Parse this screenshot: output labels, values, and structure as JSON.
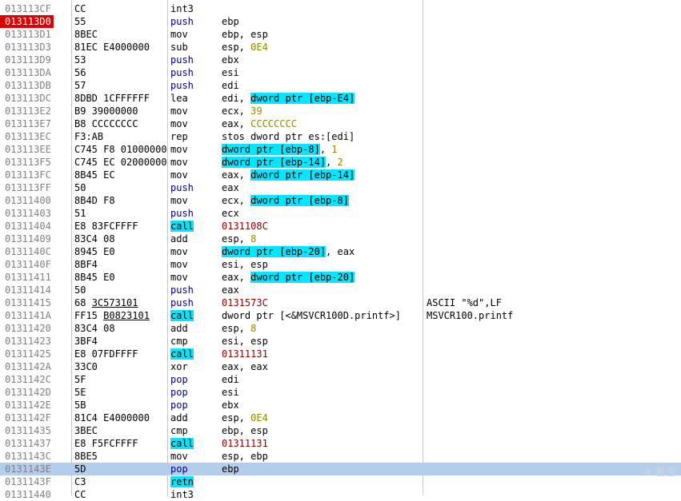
{
  "disassembly": {
    "rows": [
      {
        "addr": "013113CF",
        "hex": [
          {
            "t": "CC"
          }
        ],
        "mnemonic": "int3",
        "m_hl": false,
        "m_blue": false,
        "ops": [],
        "comment": ""
      },
      {
        "addr": "013113D0",
        "breakpoint": true,
        "hex": [
          {
            "t": "55"
          }
        ],
        "mnemonic": "push",
        "m_hl": false,
        "m_blue": true,
        "ops": [
          {
            "t": "ebp"
          }
        ],
        "comment": ""
      },
      {
        "addr": "013113D1",
        "hex": [
          {
            "t": "8BEC"
          }
        ],
        "mnemonic": "mov",
        "m_hl": false,
        "m_blue": false,
        "ops": [
          {
            "t": "ebp, esp"
          }
        ],
        "comment": ""
      },
      {
        "addr": "013113D3",
        "hex": [
          {
            "t": "81EC E4000000"
          }
        ],
        "mnemonic": "sub",
        "m_hl": false,
        "m_blue": false,
        "ops": [
          {
            "t": "esp, "
          },
          {
            "t": "0E4",
            "c": "num"
          }
        ],
        "comment": ""
      },
      {
        "addr": "013113D9",
        "hex": [
          {
            "t": "53"
          }
        ],
        "mnemonic": "push",
        "m_hl": false,
        "m_blue": true,
        "ops": [
          {
            "t": "ebx"
          }
        ],
        "comment": ""
      },
      {
        "addr": "013113DA",
        "hex": [
          {
            "t": "56"
          }
        ],
        "mnemonic": "push",
        "m_hl": false,
        "m_blue": true,
        "ops": [
          {
            "t": "esi"
          }
        ],
        "comment": ""
      },
      {
        "addr": "013113DB",
        "hex": [
          {
            "t": "57"
          }
        ],
        "mnemonic": "push",
        "m_hl": false,
        "m_blue": true,
        "ops": [
          {
            "t": "edi"
          }
        ],
        "comment": ""
      },
      {
        "addr": "013113DC",
        "hex": [
          {
            "t": "8DBD 1CFFFFFF"
          }
        ],
        "mnemonic": "lea",
        "m_hl": false,
        "m_blue": false,
        "ops": [
          {
            "t": "edi, "
          },
          {
            "t": "dword ptr [ebp-E4]",
            "c": "hl"
          }
        ],
        "comment": ""
      },
      {
        "addr": "013113E2",
        "hex": [
          {
            "t": "B9 39000000"
          }
        ],
        "mnemonic": "mov",
        "m_hl": false,
        "m_blue": false,
        "ops": [
          {
            "t": "ecx, "
          },
          {
            "t": "39",
            "c": "num"
          }
        ],
        "comment": ""
      },
      {
        "addr": "013113E7",
        "hex": [
          {
            "t": "B8 CCCCCCCC"
          }
        ],
        "mnemonic": "mov",
        "m_hl": false,
        "m_blue": false,
        "ops": [
          {
            "t": "eax, "
          },
          {
            "t": "CCCCCCCC",
            "c": "num"
          }
        ],
        "comment": ""
      },
      {
        "addr": "013113EC",
        "hex": [
          {
            "t": "F3:AB"
          }
        ],
        "mnemonic": "rep",
        "m_hl": false,
        "m_blue": false,
        "ops": [
          {
            "t": "stos dword ptr es:[edi]"
          }
        ],
        "comment": ""
      },
      {
        "addr": "013113EE",
        "hex": [
          {
            "t": "C745 F8 01000000"
          }
        ],
        "mnemonic": "mov",
        "m_hl": false,
        "m_blue": false,
        "ops": [
          {
            "t": "dword ptr [ebp-8]",
            "c": "hl"
          },
          {
            "t": ", "
          },
          {
            "t": "1",
            "c": "num"
          }
        ],
        "comment": ""
      },
      {
        "addr": "013113F5",
        "hex": [
          {
            "t": "C745 EC 02000000"
          }
        ],
        "mnemonic": "mov",
        "m_hl": false,
        "m_blue": false,
        "ops": [
          {
            "t": "dword ptr [ebp-14]",
            "c": "hl"
          },
          {
            "t": ", "
          },
          {
            "t": "2",
            "c": "num"
          }
        ],
        "comment": ""
      },
      {
        "addr": "013113FC",
        "hex": [
          {
            "t": "8B45 EC"
          }
        ],
        "mnemonic": "mov",
        "m_hl": false,
        "m_blue": false,
        "ops": [
          {
            "t": "eax, "
          },
          {
            "t": "dword ptr [ebp-14]",
            "c": "hl"
          }
        ],
        "comment": ""
      },
      {
        "addr": "013113FF",
        "hex": [
          {
            "t": "50"
          }
        ],
        "mnemonic": "push",
        "m_hl": false,
        "m_blue": true,
        "ops": [
          {
            "t": "eax"
          }
        ],
        "comment": ""
      },
      {
        "addr": "01311400",
        "hex": [
          {
            "t": "8B4D F8"
          }
        ],
        "mnemonic": "mov",
        "m_hl": false,
        "m_blue": false,
        "ops": [
          {
            "t": "ecx, "
          },
          {
            "t": "dword ptr [ebp-8]",
            "c": "hl"
          }
        ],
        "comment": ""
      },
      {
        "addr": "01311403",
        "hex": [
          {
            "t": "51"
          }
        ],
        "mnemonic": "push",
        "m_hl": false,
        "m_blue": true,
        "ops": [
          {
            "t": "ecx"
          }
        ],
        "comment": ""
      },
      {
        "addr": "01311404",
        "hex": [
          {
            "t": "E8 83FCFFFF"
          }
        ],
        "mnemonic": "call",
        "m_hl": true,
        "m_blue": false,
        "ops": [
          {
            "t": "0131108C",
            "c": "addrref"
          }
        ],
        "comment": ""
      },
      {
        "addr": "01311409",
        "hex": [
          {
            "t": "83C4 08"
          }
        ],
        "mnemonic": "add",
        "m_hl": false,
        "m_blue": false,
        "ops": [
          {
            "t": "esp, "
          },
          {
            "t": "8",
            "c": "num"
          }
        ],
        "comment": ""
      },
      {
        "addr": "0131140C",
        "hex": [
          {
            "t": "8945 E0"
          }
        ],
        "mnemonic": "mov",
        "m_hl": false,
        "m_blue": false,
        "ops": [
          {
            "t": "dword ptr [ebp-20]",
            "c": "hl"
          },
          {
            "t": ", eax"
          }
        ],
        "comment": ""
      },
      {
        "addr": "0131140F",
        "hex": [
          {
            "t": "8BF4"
          }
        ],
        "mnemonic": "mov",
        "m_hl": false,
        "m_blue": false,
        "ops": [
          {
            "t": "esi, esp"
          }
        ],
        "comment": ""
      },
      {
        "addr": "01311411",
        "hex": [
          {
            "t": "8B45 E0"
          }
        ],
        "mnemonic": "mov",
        "m_hl": false,
        "m_blue": false,
        "ops": [
          {
            "t": "eax, "
          },
          {
            "t": "dword ptr [ebp-20]",
            "c": "hl"
          }
        ],
        "comment": ""
      },
      {
        "addr": "01311414",
        "hex": [
          {
            "t": "50"
          }
        ],
        "mnemonic": "push",
        "m_hl": false,
        "m_blue": true,
        "ops": [
          {
            "t": "eax"
          }
        ],
        "comment": ""
      },
      {
        "addr": "01311415",
        "hex": [
          {
            "t": "68 "
          },
          {
            "t": "3C573101",
            "c": "ul"
          }
        ],
        "mnemonic": "push",
        "m_hl": false,
        "m_blue": true,
        "ops": [
          {
            "t": "0131573C",
            "c": "addrref"
          }
        ],
        "comment": "ASCII \"%d\",LF"
      },
      {
        "addr": "0131141A",
        "hex": [
          {
            "t": "FF15 "
          },
          {
            "t": "B0823101",
            "c": "ul"
          }
        ],
        "mnemonic": "call",
        "m_hl": true,
        "m_blue": false,
        "ops": [
          {
            "t": "dword ptr [<&MSVCR100D.printf>]"
          }
        ],
        "comment": "MSVCR100.printf"
      },
      {
        "addr": "01311420",
        "hex": [
          {
            "t": "83C4 08"
          }
        ],
        "mnemonic": "add",
        "m_hl": false,
        "m_blue": false,
        "ops": [
          {
            "t": "esp, "
          },
          {
            "t": "8",
            "c": "num"
          }
        ],
        "comment": ""
      },
      {
        "addr": "01311423",
        "hex": [
          {
            "t": "3BF4"
          }
        ],
        "mnemonic": "cmp",
        "m_hl": false,
        "m_blue": false,
        "ops": [
          {
            "t": "esi, esp"
          }
        ],
        "comment": ""
      },
      {
        "addr": "01311425",
        "hex": [
          {
            "t": "E8 07FDFFFF"
          }
        ],
        "mnemonic": "call",
        "m_hl": true,
        "m_blue": false,
        "ops": [
          {
            "t": "01311131",
            "c": "addrref"
          }
        ],
        "comment": ""
      },
      {
        "addr": "0131142A",
        "hex": [
          {
            "t": "33C0"
          }
        ],
        "mnemonic": "xor",
        "m_hl": false,
        "m_blue": false,
        "ops": [
          {
            "t": "eax, eax"
          }
        ],
        "comment": ""
      },
      {
        "addr": "0131142C",
        "hex": [
          {
            "t": "5F"
          }
        ],
        "mnemonic": "pop",
        "m_hl": false,
        "m_blue": true,
        "ops": [
          {
            "t": "edi"
          }
        ],
        "comment": ""
      },
      {
        "addr": "0131142D",
        "hex": [
          {
            "t": "5E"
          }
        ],
        "mnemonic": "pop",
        "m_hl": false,
        "m_blue": true,
        "ops": [
          {
            "t": "esi"
          }
        ],
        "comment": ""
      },
      {
        "addr": "0131142E",
        "hex": [
          {
            "t": "5B"
          }
        ],
        "mnemonic": "pop",
        "m_hl": false,
        "m_blue": true,
        "ops": [
          {
            "t": "ebx"
          }
        ],
        "comment": ""
      },
      {
        "addr": "0131142F",
        "hex": [
          {
            "t": "81C4 E4000000"
          }
        ],
        "mnemonic": "add",
        "m_hl": false,
        "m_blue": false,
        "ops": [
          {
            "t": "esp, "
          },
          {
            "t": "0E4",
            "c": "num"
          }
        ],
        "comment": ""
      },
      {
        "addr": "01311435",
        "hex": [
          {
            "t": "3BEC"
          }
        ],
        "mnemonic": "cmp",
        "m_hl": false,
        "m_blue": false,
        "ops": [
          {
            "t": "ebp, esp"
          }
        ],
        "comment": ""
      },
      {
        "addr": "01311437",
        "hex": [
          {
            "t": "E8 F5FCFFFF"
          }
        ],
        "mnemonic": "call",
        "m_hl": true,
        "m_blue": false,
        "ops": [
          {
            "t": "01311131",
            "c": "addrref"
          }
        ],
        "comment": ""
      },
      {
        "addr": "0131143C",
        "hex": [
          {
            "t": "8BE5"
          }
        ],
        "mnemonic": "mov",
        "m_hl": false,
        "m_blue": false,
        "ops": [
          {
            "t": "esp, ebp"
          }
        ],
        "comment": ""
      },
      {
        "addr": "0131143E",
        "selected": true,
        "hex": [
          {
            "t": "5D"
          }
        ],
        "mnemonic": "pop",
        "m_hl": false,
        "m_blue": true,
        "ops": [
          {
            "t": "ebp"
          }
        ],
        "comment": ""
      },
      {
        "addr": "0131143F",
        "hex": [
          {
            "t": "C3"
          }
        ],
        "mnemonic": "retn",
        "m_hl": true,
        "m_blue": false,
        "ops": [],
        "comment": ""
      },
      {
        "addr": "01311440",
        "hex": [
          {
            "t": "CC"
          }
        ],
        "mnemonic": "int3",
        "m_hl": false,
        "m_blue": false,
        "ops": [],
        "comment": ""
      }
    ]
  },
  "watermark": {
    "text": "看雪",
    "icon": "snowflake-icon"
  },
  "colors": {
    "operand_highlight": "#00e8ff",
    "breakpoint": "#e00000",
    "selection": "#b4cdea",
    "mnemonic_blue": "#00008b",
    "immediate": "#8b8b00",
    "address_ref": "#8b0000"
  }
}
